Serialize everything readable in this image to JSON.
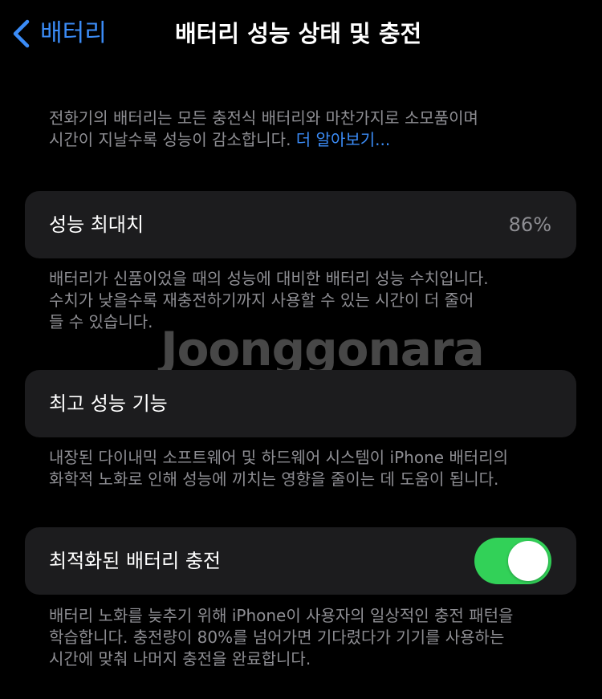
{
  "nav": {
    "back_label": "배터리",
    "title": "배터리 성능 상태 및 충전"
  },
  "intro": {
    "lines": [
      "전화기의 배터리는 모든 충전식 배터리와 마찬가지로 소모품이며",
      "시간이 지날수록 성능이 감소합니다."
    ],
    "link": "더 알아보기..."
  },
  "max_capacity": {
    "label": "성능 최대치",
    "value": "86%",
    "footnote_lines": [
      "배터리가 신품이었을 때의 성능에 대비한 배터리 성능 수치입니다.",
      "수치가 낮을수록 재충전하기까지 사용할 수 있는 시간이 더 줄어",
      "들 수 있습니다."
    ]
  },
  "peak_performance": {
    "label": "최고 성능 기능",
    "footnote_lines": [
      "내장된 다이내믹 소프트웨어 및 하드웨어 시스템이 iPhone 배터리의",
      "화학적 노화로 인해 성능에 끼치는 영향을 줄이는 데 도움이 됩니다."
    ]
  },
  "optimized_charging": {
    "label": "최적화된 배터리 충전",
    "toggle_on": true,
    "footnote_lines": [
      "배터리 노화를 늦추기 위해 iPhone이 사용자의 일상적인 충전 패턴을",
      "학습합니다. 충전량이 80%를 넘어가면 기다렸다가 기기를 사용하는",
      "시간에 맞춰 나머지 충전을 완료합니다."
    ]
  },
  "watermark": "Joonggonara",
  "colors": {
    "background": "#000000",
    "card": "#1c1c1e",
    "accent": "#3b8cf7",
    "secondary_text": "#8e8e93",
    "toggle_on": "#32d158"
  },
  "icons": {
    "back": "chevron-left-icon"
  }
}
